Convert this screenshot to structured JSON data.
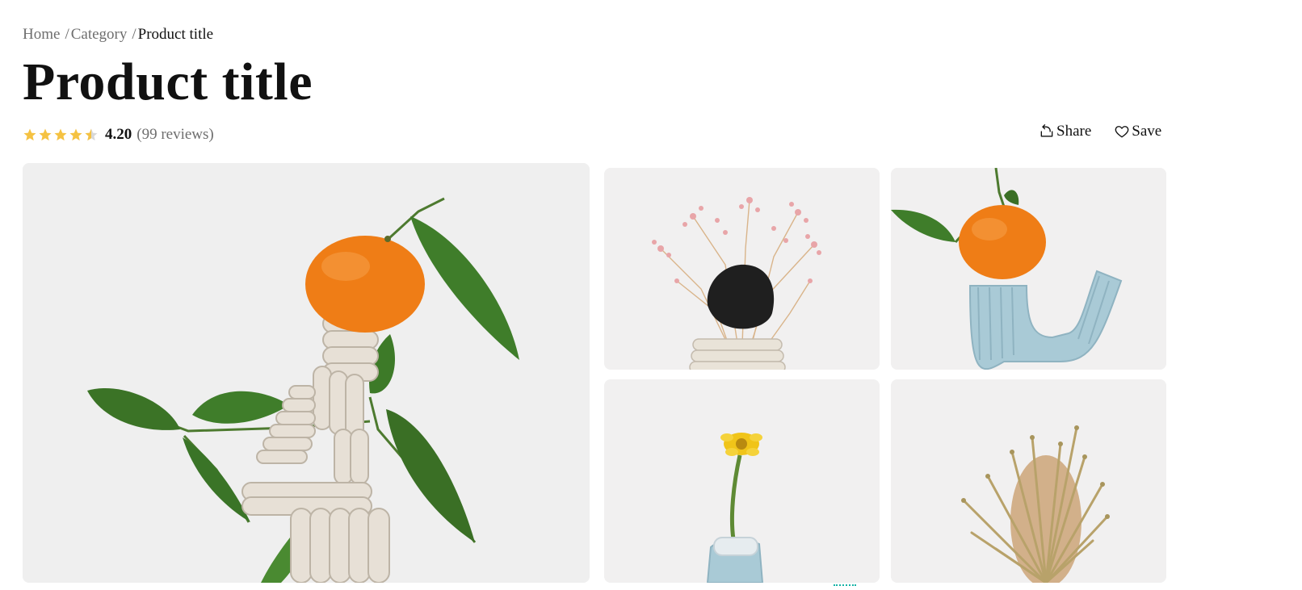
{
  "breadcrumb": {
    "items": [
      "Home",
      "Category"
    ],
    "separator": "/",
    "current": "Product title"
  },
  "product": {
    "title": "Product title",
    "rating": "4.20",
    "reviews": "(99 reviews)",
    "rating_value": 4.2,
    "star_color": "#f5c242"
  },
  "actions": {
    "share_label": "Share",
    "save_label": "Save"
  },
  "gallery": {
    "images": [
      {
        "name": "orange-clay-sculpture-image"
      },
      {
        "name": "pink-flowers-black-stone-image"
      },
      {
        "name": "orange-blue-clay-image"
      },
      {
        "name": "yellow-flower-blue-vase-image"
      },
      {
        "name": "banksia-flower-image"
      }
    ]
  }
}
